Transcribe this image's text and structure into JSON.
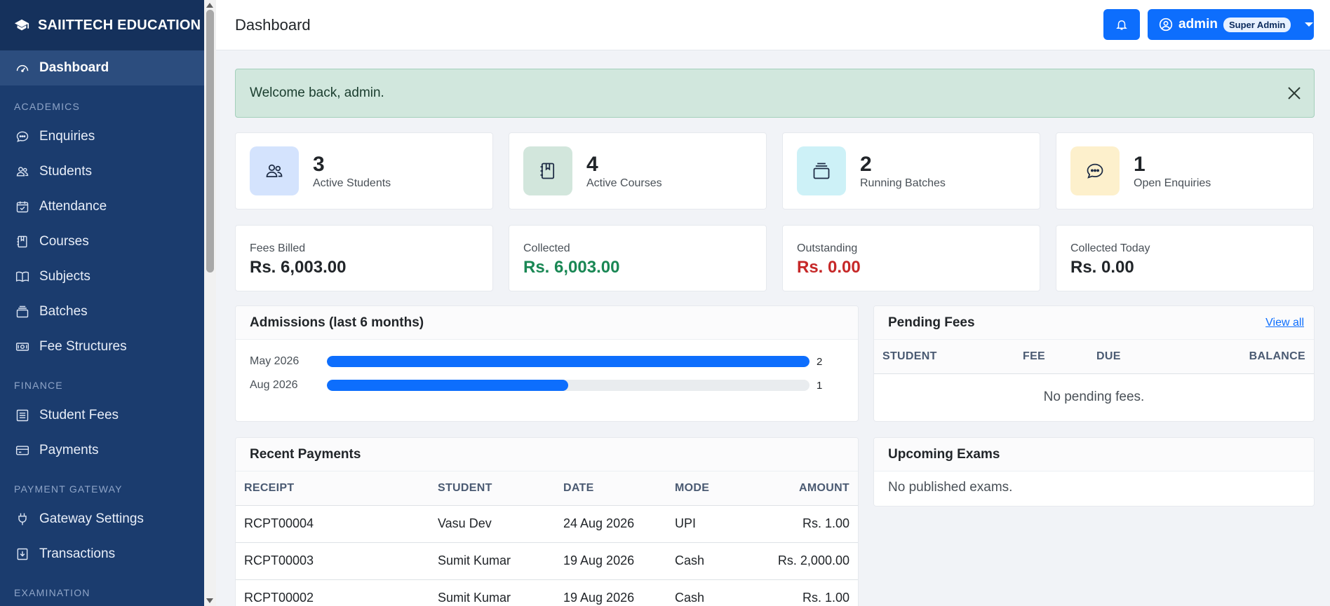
{
  "sidebar": {
    "brand": "SAIITTECH EDUCATION",
    "dashboard": "Dashboard",
    "sections": {
      "academics": "ACADEMICS",
      "finance": "FINANCE",
      "payment_gateway": "PAYMENT GATEWAY",
      "examination": "EXAMINATION"
    },
    "items": {
      "enquiries": "Enquiries",
      "students": "Students",
      "attendance": "Attendance",
      "courses": "Courses",
      "subjects": "Subjects",
      "batches": "Batches",
      "fee_structures": "Fee Structures",
      "student_fees": "Student Fees",
      "payments": "Payments",
      "gateway_settings": "Gateway Settings",
      "transactions": "Transactions"
    }
  },
  "header": {
    "title": "Dashboard",
    "user": "admin",
    "role": "Super Admin"
  },
  "alert": {
    "message": "Welcome back, admin."
  },
  "stats": {
    "students": {
      "value": "3",
      "label": "Active Students"
    },
    "courses": {
      "value": "4",
      "label": "Active Courses"
    },
    "batches": {
      "value": "2",
      "label": "Running Batches"
    },
    "enquiries": {
      "value": "1",
      "label": "Open Enquiries"
    }
  },
  "finance": {
    "billed": {
      "label": "Fees Billed",
      "value": "Rs. 6,003.00"
    },
    "collected": {
      "label": "Collected",
      "value": "Rs. 6,003.00"
    },
    "outstanding": {
      "label": "Outstanding",
      "value": "Rs. 0.00"
    },
    "today": {
      "label": "Collected Today",
      "value": "Rs. 0.00"
    }
  },
  "admissions": {
    "title": "Admissions (last 6 months)",
    "max": 2,
    "rows": [
      {
        "label": "May 2026",
        "count": 2
      },
      {
        "label": "Aug 2026",
        "count": 1
      }
    ]
  },
  "pending_fees": {
    "title": "Pending Fees",
    "view_all": "View all",
    "columns": {
      "student": "STUDENT",
      "fee": "FEE",
      "due": "DUE",
      "balance": "BALANCE"
    },
    "empty": "No pending fees."
  },
  "recent_payments": {
    "title": "Recent Payments",
    "columns": {
      "receipt": "RECEIPT",
      "student": "STUDENT",
      "date": "DATE",
      "mode": "MODE",
      "amount": "AMOUNT"
    },
    "rows": [
      {
        "receipt": "RCPT00004",
        "student": "Vasu Dev",
        "date": "24 Aug 2026",
        "mode": "UPI",
        "amount": "Rs. 1.00"
      },
      {
        "receipt": "RCPT00003",
        "student": "Sumit Kumar",
        "date": "19 Aug 2026",
        "mode": "Cash",
        "amount": "Rs. 2,000.00"
      },
      {
        "receipt": "RCPT00002",
        "student": "Sumit Kumar",
        "date": "19 Aug 2026",
        "mode": "Cash",
        "amount": "Rs. 1.00"
      }
    ]
  },
  "upcoming_exams": {
    "title": "Upcoming Exams",
    "empty": "No published exams."
  },
  "colors": {
    "sidebar": "#1b3c6e",
    "primary": "#0d6efd",
    "success_text": "#198754",
    "danger_text": "#c62828",
    "alert_bg": "#d1e7dd"
  }
}
